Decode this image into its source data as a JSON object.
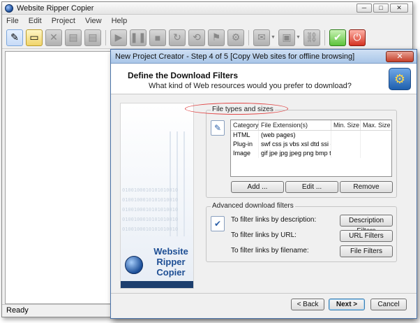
{
  "app": {
    "title": "Website Ripper Copier",
    "window_buttons": {
      "minimize": "─",
      "maximize": "□",
      "close": "✕"
    },
    "menu": [
      "File",
      "Edit",
      "Project",
      "View",
      "Help"
    ],
    "toolbar_icons": [
      "wizard-icon",
      "open-folder-icon",
      "delete-icon",
      "tool-icon",
      "tool-icon",
      "play-icon",
      "pause-icon",
      "stop-icon",
      "refresh-icon",
      "refresh-icon",
      "filter-icon",
      "settings-icon",
      "mail-icon",
      "monitor-icon",
      "link-icon",
      "check-icon",
      "exit-icon"
    ],
    "status": "Ready"
  },
  "dialog": {
    "title": "New Project Creator - Step 4 of 5 [Copy Web sites for offline browsing]",
    "close": "✕",
    "heading": "Define the Download Filters",
    "subheading": "What kind of Web resources would you prefer to download?",
    "banner": {
      "line1": "Website",
      "line2": "Ripper",
      "line3": "Copier",
      "binary": "0100100010101010010"
    },
    "filetypes": {
      "group_title": "File types and sizes",
      "columns": [
        "Category",
        "File Extension(s)",
        "Min. Size",
        "Max. Size"
      ],
      "rows": [
        {
          "category": "HTML",
          "extensions": "(web pages)",
          "min": "",
          "max": ""
        },
        {
          "category": "Plug-in",
          "extensions": "swf css js vbs xsl dtd ssi cl...",
          "min": "",
          "max": ""
        },
        {
          "category": "Image",
          "extensions": "gif jpe jpg jpeg png bmp tif ...",
          "min": "",
          "max": ""
        }
      ],
      "add_button": "Add ...",
      "edit_button": "Edit ...",
      "remove_button": "Remove"
    },
    "advanced": {
      "group_title": "Advanced download  filters",
      "desc_label": "To filter links by description:",
      "desc_button": "Description Filters",
      "url_label": "To filter links by URL:",
      "url_button": "URL Filters",
      "file_label": "To filter links by filename:",
      "file_button": "File Filters"
    },
    "footer": {
      "back": "< Back",
      "next": "Next >",
      "cancel": "Cancel"
    }
  }
}
